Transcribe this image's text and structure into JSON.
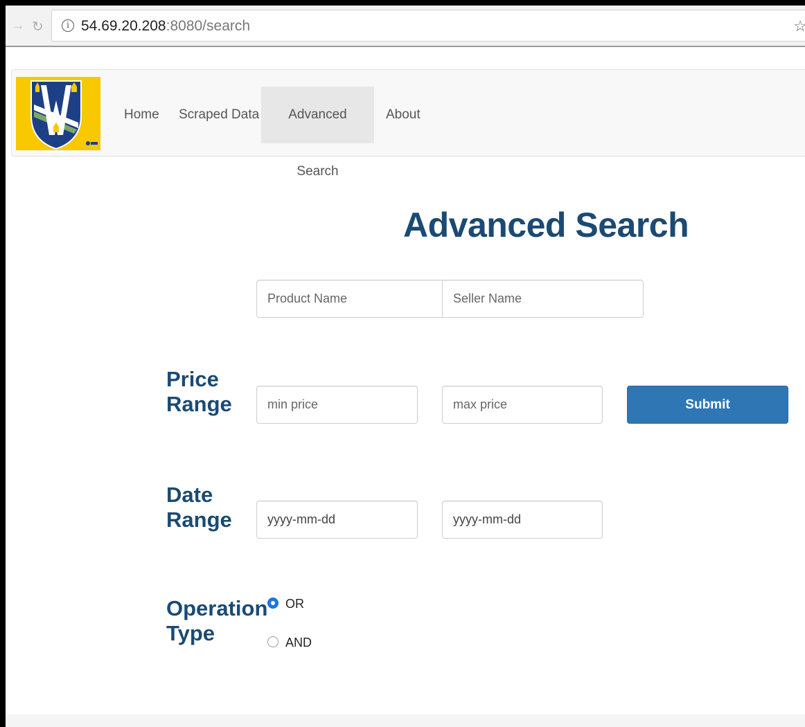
{
  "browser": {
    "url_host": "54.69.20.208",
    "url_rest": ":8080/search"
  },
  "navbar": {
    "logo_alt": "University of Windsor logo",
    "items": [
      {
        "label": "Home"
      },
      {
        "label": "Scraped Data"
      },
      {
        "label": "Advanced Search",
        "active": true
      },
      {
        "label": "About"
      }
    ]
  },
  "page": {
    "title": "Advanced Search"
  },
  "form": {
    "product_name_placeholder": "Product Name",
    "seller_name_placeholder": "Seller Name",
    "price_label_line1": "Price",
    "price_label_line2": "Range",
    "min_price_placeholder": "min price",
    "max_price_placeholder": "max price",
    "submit_label": "Submit",
    "date_label_line1": "Date",
    "date_label_line2": "Range",
    "date_from_placeholder": "yyyy-mm-dd",
    "date_to_placeholder": "yyyy-mm-dd",
    "operation_label_line1": "Operation",
    "operation_label_line2": "Type",
    "operation_options": [
      {
        "label": "OR",
        "checked": true
      },
      {
        "label": "AND",
        "checked": false
      }
    ]
  },
  "colors": {
    "heading": "#1b4a73",
    "primary_button": "#2f76b5",
    "logo_background": "#f8c800"
  }
}
